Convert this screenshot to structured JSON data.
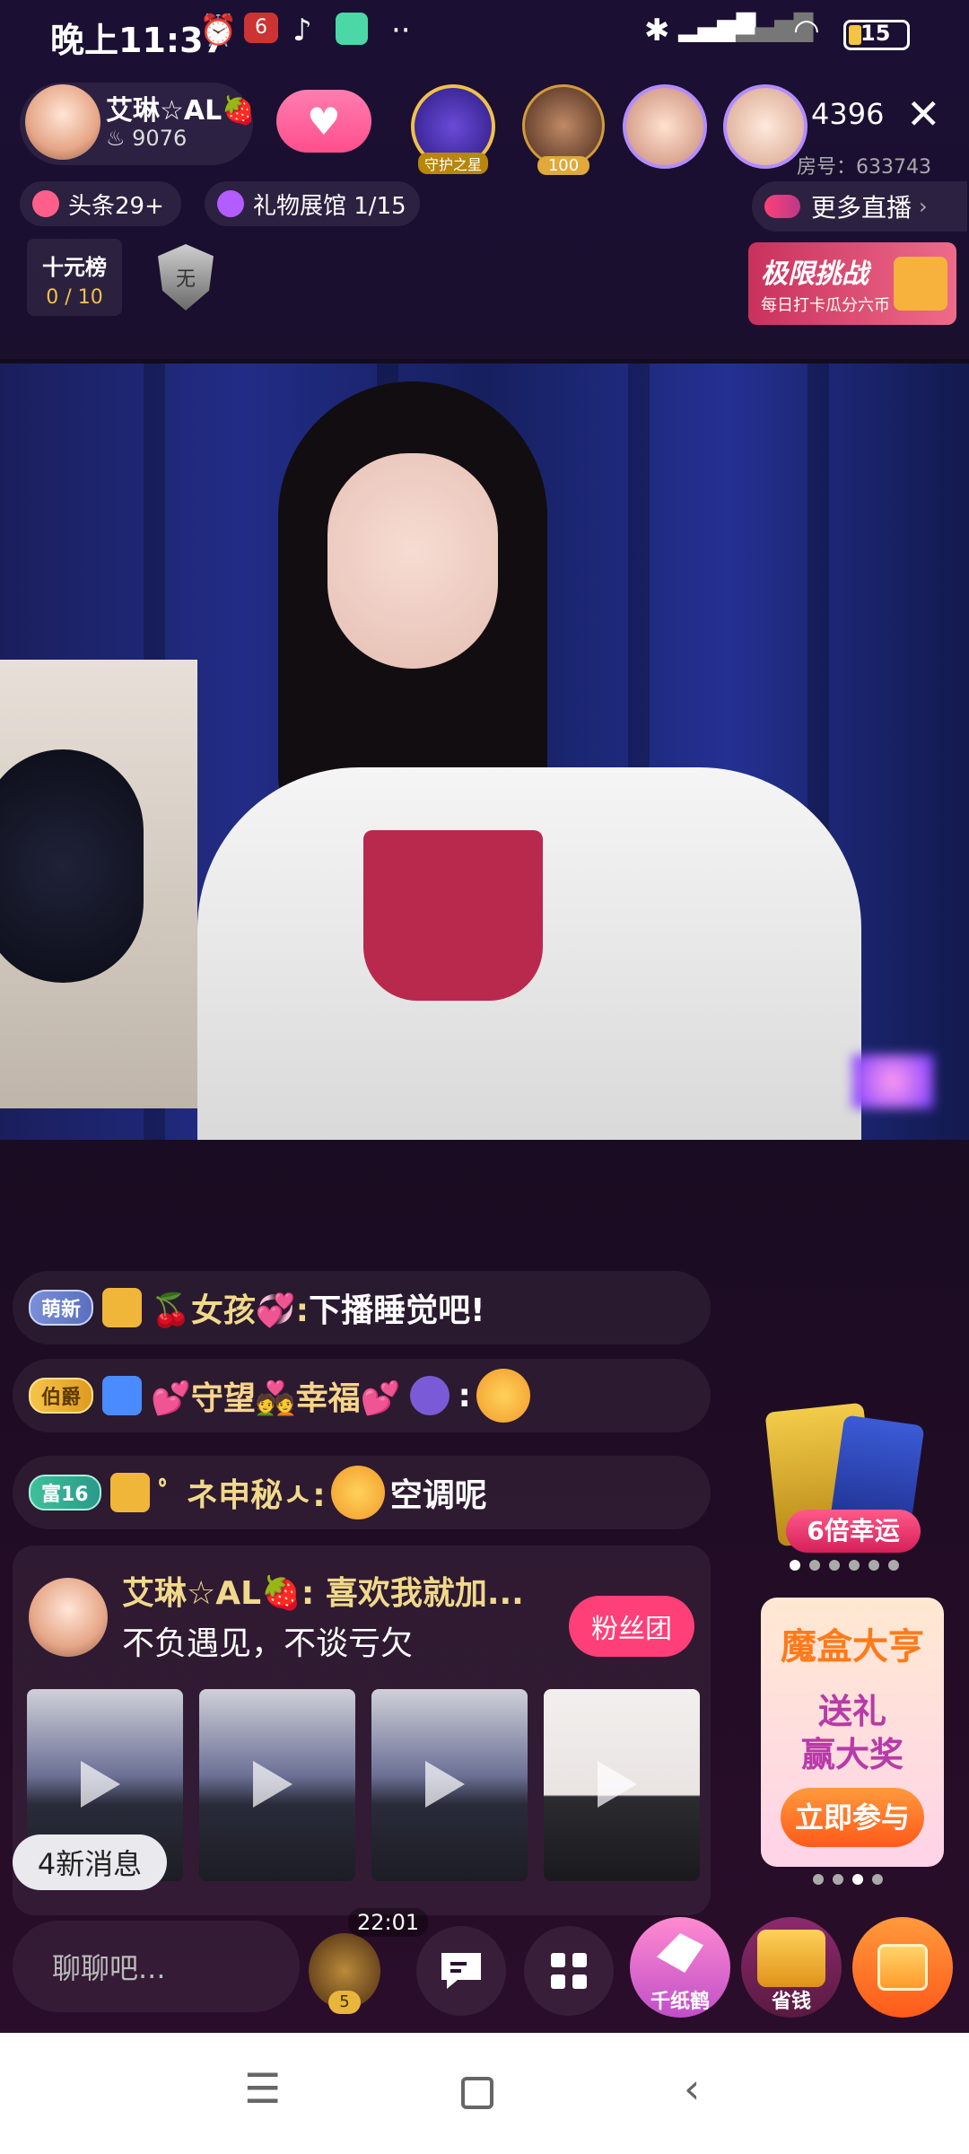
{
  "status_bar": {
    "time": "晚上11:37",
    "battery": "15"
  },
  "anchor": {
    "name": "艾琳☆AL🍓",
    "heat": "9076"
  },
  "top_right": {
    "viewers": "4396",
    "room_id": "房号：633743"
  },
  "guardians": {
    "badge1": "守护之星",
    "badge2": "100"
  },
  "chips": {
    "headline": "头条29+",
    "gift_hall": "礼物展馆 1/15",
    "more_live": "更多直播"
  },
  "rank": {
    "title": "十元榜",
    "count": "0 / 10",
    "shield": "无"
  },
  "challenge": {
    "title": "极限挑战",
    "sub": "每日打卡瓜分六币"
  },
  "messages": [
    {
      "badge": "萌新",
      "user": "🍒女孩💞:",
      "text": " 下播睡觉吧!"
    },
    {
      "badge": "伯爵",
      "user": "💕守望💑幸福💕",
      "text": " :"
    },
    {
      "badge": "富16",
      "user": "ﾟ ネ申秘ㅅ:",
      "text": "空调呢"
    }
  ],
  "card": {
    "name": "艾琳☆AL🍓:  喜欢我就加...",
    "msg": "不负遇见，不谈亏欠",
    "fan_btn": "粉丝团"
  },
  "new_msgs": "4新消息",
  "lucky": {
    "label": "6倍幸运"
  },
  "mohe": {
    "title": "魔盒大亨",
    "line1": "送礼",
    "line2": "赢大奖",
    "btn": "立即参与"
  },
  "bottom": {
    "chat_placeholder": "聊聊吧...",
    "timer": "22:01",
    "chest_count": "5",
    "crane_label": "千纸鹤",
    "save_label": "省钱"
  },
  "icons": {
    "close": "close-icon",
    "chat": "chat-bubble-icon",
    "grid": "grid-icon",
    "gift": "gift-icon"
  }
}
